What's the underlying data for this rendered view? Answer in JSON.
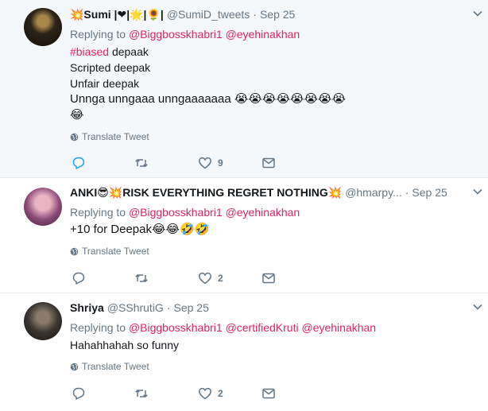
{
  "tweets": [
    {
      "name": "💥Sumi |❤|🌟|🌻|",
      "handle": "@SumiD_tweets",
      "date": "Sep 25",
      "replying_label": "Replying to",
      "mentions": [
        "@Biggbosskhabri1",
        "@eyehinakhan"
      ],
      "hashtag": "#biased",
      "lines": [
        "depaak",
        "Scripted deepak",
        "Unfair deepak",
        "Unnga unngaaa unngaaaaaaa 😭😭😭😭😭😭😭😭",
        "😂"
      ],
      "translate": "Translate Tweet",
      "likes": "9"
    },
    {
      "name": "ANKI😎💥RISK EVERYTHING REGRET NOTHING💥",
      "handle": "@hmarpy...",
      "date": "Sep 25",
      "replying_label": "Replying to",
      "mentions": [
        "@Biggbosskhabri1",
        "@eyehinakhan"
      ],
      "lines": [
        "+10 for Deepak😂😂🤣🤣"
      ],
      "translate": "Translate Tweet",
      "likes": "2"
    },
    {
      "name": "Shriya",
      "handle": "@SShrutiG",
      "date": "Sep 25",
      "replying_label": "Replying to",
      "mentions": [
        "@Biggbosskhabri1",
        "@certifiedKruti",
        "@eyehinakhan"
      ],
      "lines": [
        "Hahahhahah so funny"
      ],
      "translate": "Translate Tweet",
      "likes": "2"
    }
  ],
  "icons": {
    "reply": "reply-icon",
    "retweet": "retweet-icon",
    "like": "heart-icon",
    "message": "direct-message-icon",
    "menu": "chevron-down-icon",
    "translate": "globe-icon"
  },
  "colors": {
    "mention": "#e0245e",
    "muted": "#657786",
    "highlight_bg": "#f5f8fa",
    "reply_active": "#1da1f2"
  }
}
